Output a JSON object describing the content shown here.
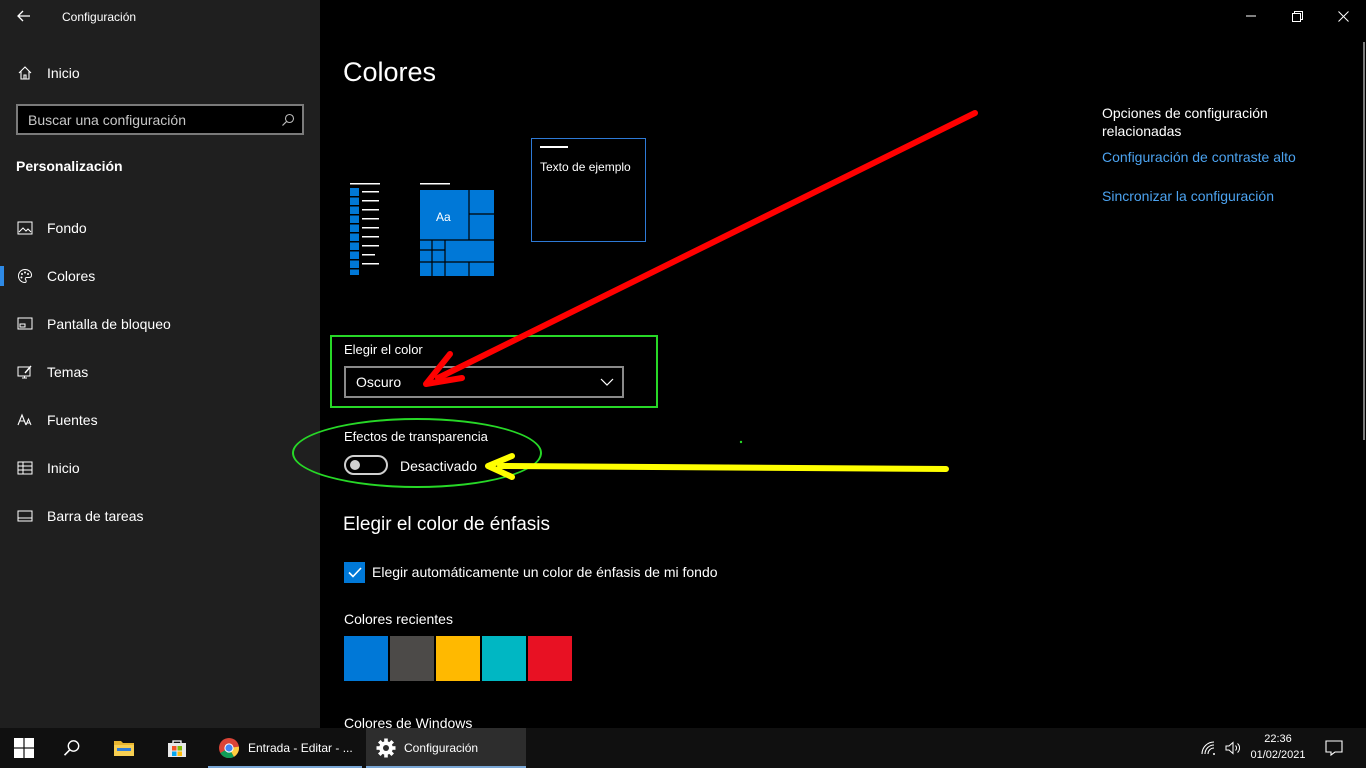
{
  "window": {
    "title": "Configuración"
  },
  "sidebar": {
    "home_label": "Inicio",
    "search_placeholder": "Buscar una configuración",
    "section_title": "Personalización",
    "items": [
      {
        "label": "Fondo",
        "icon": "image-icon"
      },
      {
        "label": "Colores",
        "icon": "palette-icon",
        "active": true
      },
      {
        "label": "Pantalla de bloqueo",
        "icon": "lock-screen-icon"
      },
      {
        "label": "Temas",
        "icon": "themes-icon"
      },
      {
        "label": "Fuentes",
        "icon": "fonts-icon"
      },
      {
        "label": "Inicio",
        "icon": "start-icon"
      },
      {
        "label": "Barra de tareas",
        "icon": "taskbar-icon"
      }
    ]
  },
  "main": {
    "title": "Colores",
    "preview": {
      "sample_text": "Texto de ejemplo",
      "tile_text": "Aa"
    },
    "choose_color": {
      "label": "Elegir el color",
      "value": "Oscuro"
    },
    "transparency": {
      "label": "Efectos de transparencia",
      "state": "Desactivado",
      "on": false
    },
    "accent": {
      "title": "Elegir el color de énfasis",
      "auto_label": "Elegir automáticamente un color de énfasis de mi fondo",
      "auto_checked": true,
      "recent_title": "Colores recientes",
      "recent_colors": [
        "#0078d7",
        "#4c4a48",
        "#ffb900",
        "#00b7c3",
        "#e81123"
      ],
      "windows_colors_title": "Colores de Windows"
    }
  },
  "related": {
    "title": "Opciones de configuración relacionadas",
    "links": [
      "Configuración de contraste alto",
      "Sincronizar la configuración"
    ]
  },
  "taskbar": {
    "apps": [
      {
        "label": "Entrada - Editar - ...",
        "icon": "chrome-icon"
      },
      {
        "label": "Configuración",
        "icon": "settings-icon"
      }
    ],
    "time": "22:36",
    "date": "01/02/2021"
  },
  "colors": {
    "accent": "#0078d7",
    "link": "#4ca3f0",
    "annotation_red": "#ff0000",
    "annotation_yellow": "#ffff00",
    "annotation_green": "#27d827"
  }
}
